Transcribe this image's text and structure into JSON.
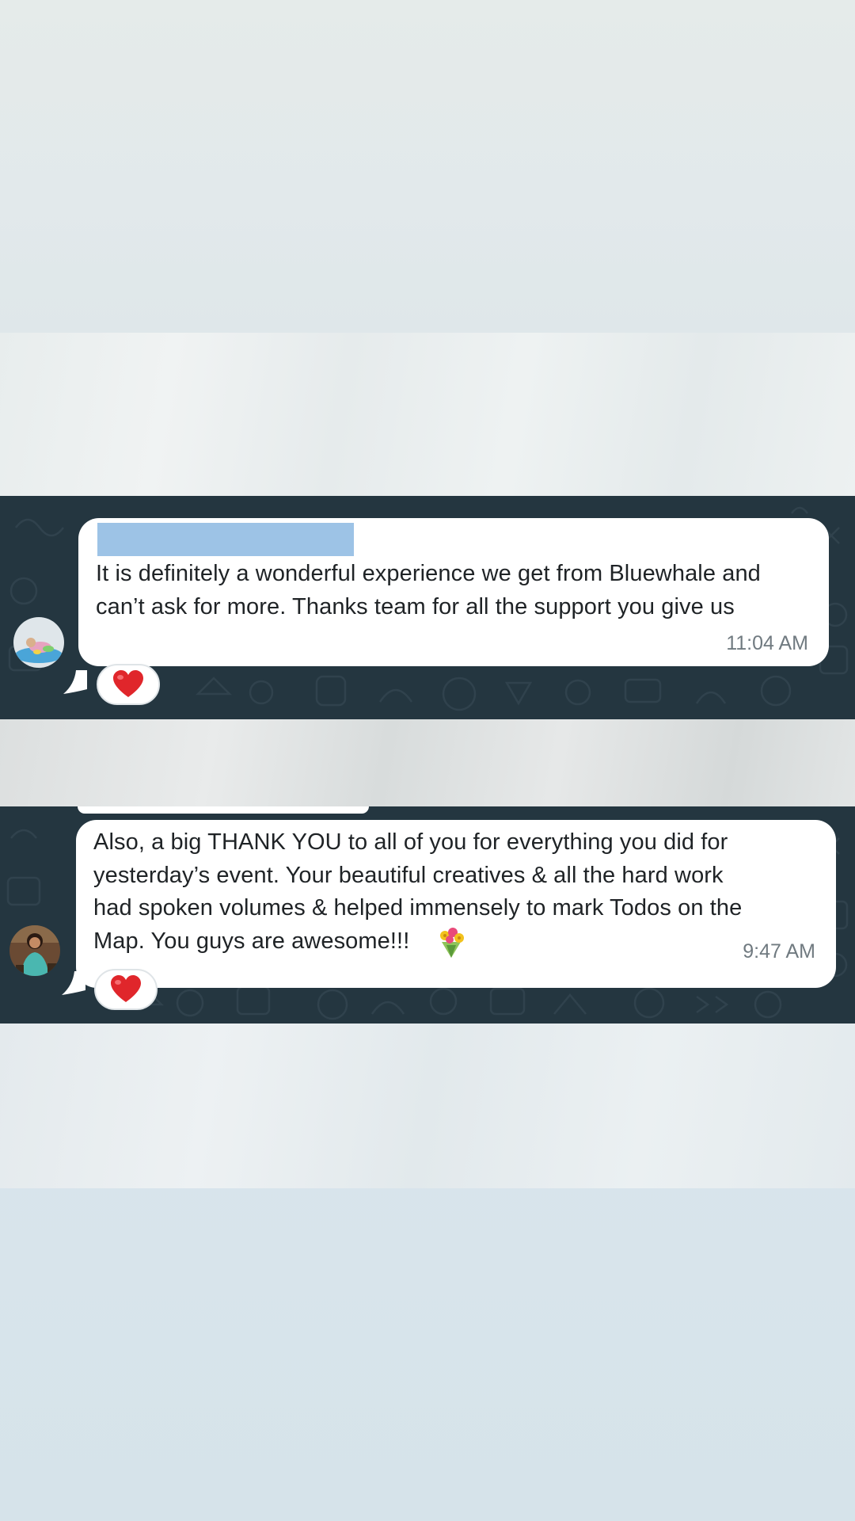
{
  "messages": [
    {
      "sender_name": "",
      "text": "It is definitely a wonderful experience we get from Bluewhale and\ncan’t ask for more. Thanks team for all the support you give us",
      "time": "11:04 AM",
      "reaction_icon": "heart-icon"
    },
    {
      "text": "Also, a big THANK YOU to all of you for everything you did for\nyesterday’s event. Your beautiful creatives & all the hard work\nhad spoken volumes & helped immensely to mark Todos on the\nMap. You guys are awesome!!!",
      "emoji_icon": "bouquet-icon",
      "time": "9:47 AM",
      "reaction_icon": "heart-icon"
    }
  ],
  "colors": {
    "chat_background": "#243640",
    "bubble": "#ffffff",
    "redaction": "#9dc3e6",
    "heart": "#e0262b",
    "timestamp": "#707a80"
  }
}
